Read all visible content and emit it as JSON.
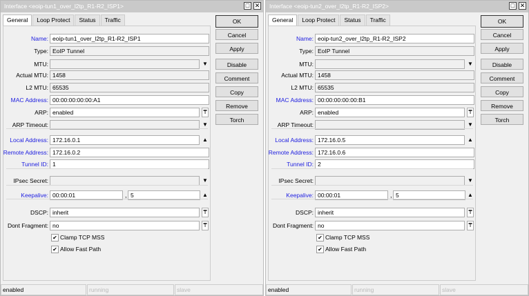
{
  "buttons": [
    "OK",
    "Cancel",
    "Apply",
    "Disable",
    "Comment",
    "Copy",
    "Remove",
    "Torch"
  ],
  "tabs": [
    "General",
    "Loop Protect",
    "Status",
    "Traffic"
  ],
  "labels": {
    "name": "Name:",
    "type": "Type:",
    "mtu": "MTU:",
    "actual_mtu": "Actual MTU:",
    "l2_mtu": "L2 MTU:",
    "mac": "MAC Address:",
    "arp": "ARP:",
    "arp_timeout": "ARP Timeout:",
    "local": "Local Address:",
    "remote": "Remote Address:",
    "tunnel": "Tunnel ID:",
    "ipsec": "IPsec Secret:",
    "keepalive": "Keepalive:",
    "dscp": "DSCP:",
    "df": "Dont Fragment:",
    "clamp": "Clamp TCP MSS",
    "fastpath": "Allow Fast Path",
    "comma": ","
  },
  "windows": [
    {
      "title": "Interface <eoip-tun1_over_l2tp_R1-R2_ISP1>",
      "name": "eoip-tun1_over_l2tp_R1-R2_ISP1",
      "type": "EoIP Tunnel",
      "mtu": "",
      "actual_mtu": "1458",
      "l2_mtu": "65535",
      "mac": "00:00:00:00:00:A1",
      "arp": "enabled",
      "arp_timeout": "",
      "local": "172.16.0.1",
      "remote": "172.16.0.2",
      "tunnel": "1",
      "ipsec": "",
      "keepalive_interval": "00:00:01",
      "keepalive_retries": "5",
      "dscp": "inherit",
      "df": "no",
      "clamp": true,
      "fastpath": true,
      "status": [
        "enabled",
        "running",
        "slave"
      ]
    },
    {
      "title": "Interface <eoip-tun2_over_l2tp_R1-R2_ISP2>",
      "name": "eoip-tun2_over_l2tp_R1-R2_ISP2",
      "type": "EoIP Tunnel",
      "mtu": "",
      "actual_mtu": "1458",
      "l2_mtu": "65535",
      "mac": "00:00:00:00:00:B1",
      "arp": "enabled",
      "arp_timeout": "",
      "local": "172.16.0.5",
      "remote": "172.16.0.6",
      "tunnel": "2",
      "ipsec": "",
      "keepalive_interval": "00:00:01",
      "keepalive_retries": "5",
      "dscp": "inherit",
      "df": "no",
      "clamp": true,
      "fastpath": true,
      "status": [
        "enabled",
        "running",
        "slave"
      ]
    }
  ]
}
